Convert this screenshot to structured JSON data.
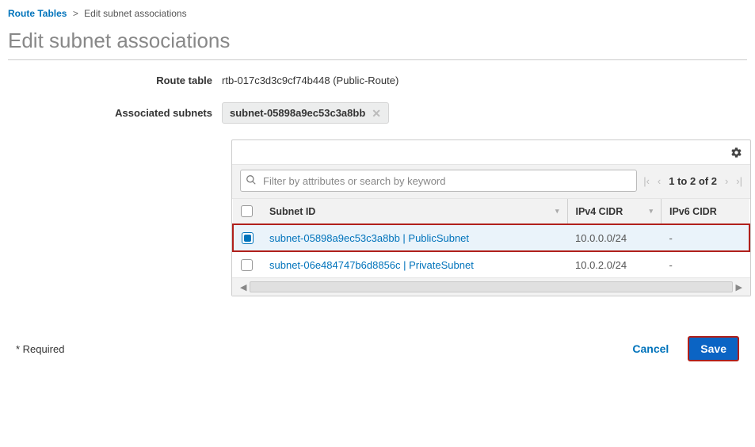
{
  "breadcrumb": {
    "root": "Route Tables",
    "sep": ">",
    "current": "Edit subnet associations"
  },
  "page_title": "Edit subnet associations",
  "form": {
    "route_table_label": "Route table",
    "route_table_value": "rtb-017c3d3c9cf74b448 (Public-Route)",
    "assoc_label": "Associated subnets",
    "assoc_chip": "subnet-05898a9ec53c3a8bb"
  },
  "search": {
    "placeholder": "Filter by attributes or search by keyword"
  },
  "pager": {
    "range": "1 to 2 of 2"
  },
  "columns": {
    "subnet_id": "Subnet ID",
    "ipv4": "IPv4 CIDR",
    "ipv6": "IPv6 CIDR"
  },
  "rows": [
    {
      "selected": true,
      "highlight": true,
      "subnet": "subnet-05898a9ec53c3a8bb | PublicSubnet",
      "ipv4": "10.0.0.0/24",
      "ipv6": "-"
    },
    {
      "selected": false,
      "highlight": false,
      "subnet": "subnet-06e484747b6d8856c | PrivateSubnet",
      "ipv4": "10.0.2.0/24",
      "ipv6": "-"
    }
  ],
  "footer": {
    "required": "* Required",
    "cancel": "Cancel",
    "save": "Save"
  }
}
